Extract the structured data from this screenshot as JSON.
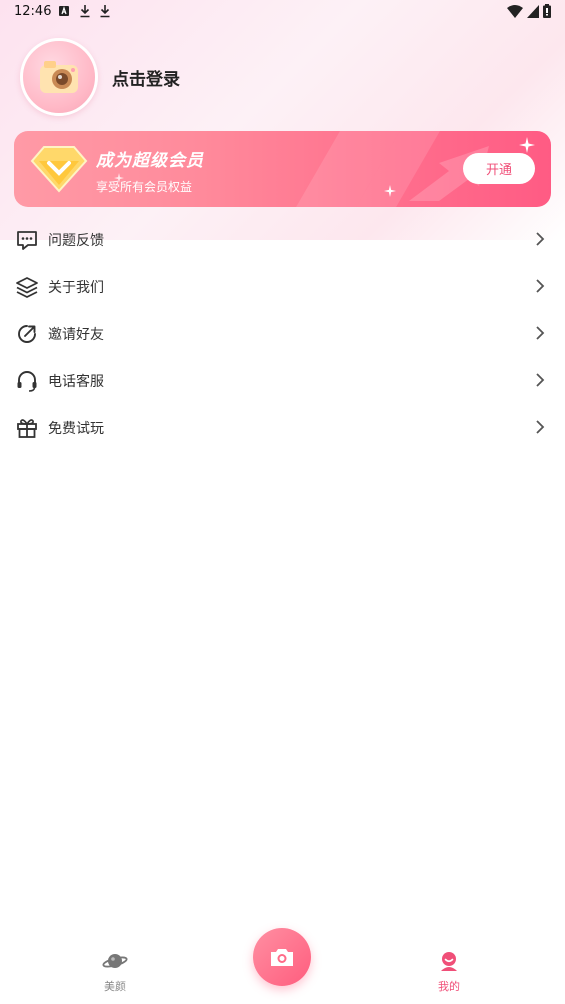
{
  "status_bar": {
    "time": "12:46"
  },
  "profile": {
    "login_label": "点击登录"
  },
  "vip": {
    "title": "成为超级会员",
    "subtitle": "享受所有会员权益",
    "button_label": "开通"
  },
  "menu": {
    "items": [
      {
        "label": "问题反馈",
        "icon": "feedback-icon"
      },
      {
        "label": "关于我们",
        "icon": "layers-icon"
      },
      {
        "label": "邀请好友",
        "icon": "share-icon"
      },
      {
        "label": "电话客服",
        "icon": "headset-icon"
      },
      {
        "label": "免费试玩",
        "icon": "gift-icon"
      }
    ]
  },
  "bottom_nav": {
    "beauty_label": "美颜",
    "mine_label": "我的"
  },
  "colors": {
    "accent": "#f04f78",
    "banner_start": "#ff9aa6",
    "banner_end": "#ff5b84"
  }
}
